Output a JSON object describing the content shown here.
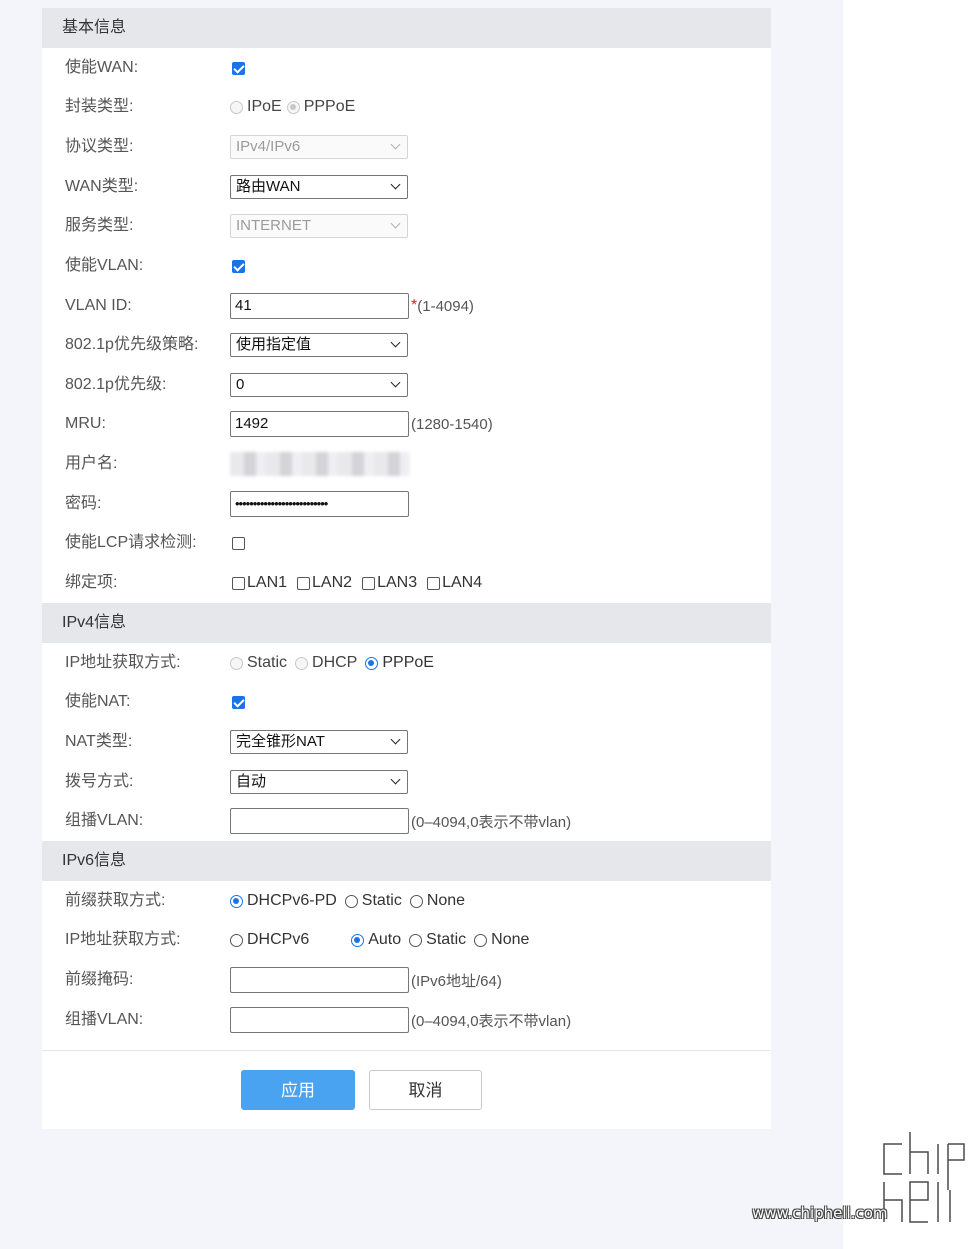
{
  "sections": {
    "basic": "基本信息",
    "ipv4": "IPv4信息",
    "ipv6": "IPv6信息"
  },
  "basic": {
    "enable_wan": {
      "label": "使能WAN:",
      "checked": true
    },
    "encap": {
      "label": "封装类型:",
      "options": [
        "IPoE",
        "PPPoE"
      ],
      "selected": "PPPoE"
    },
    "protocol": {
      "label": "协议类型:",
      "value": "IPv4/IPv6"
    },
    "wan_type": {
      "label": "WAN类型:",
      "value": "路由WAN"
    },
    "service": {
      "label": "服务类型:",
      "value": "INTERNET"
    },
    "enable_vlan": {
      "label": "使能VLAN:",
      "checked": true
    },
    "vlan_id": {
      "label": "VLAN ID:",
      "value": "41",
      "required": "*",
      "hint": "(1-4094)"
    },
    "p8021_policy": {
      "label": "802.1p优先级策略:",
      "value": "使用指定值"
    },
    "p8021": {
      "label": "802.1p优先级:",
      "value": "0"
    },
    "mru": {
      "label": "MRU:",
      "value": "1492",
      "hint": "(1280-1540)"
    },
    "username": {
      "label": "用户名:"
    },
    "password": {
      "label": "密码:",
      "value": "••••••••••••••••••••••••••"
    },
    "lcp": {
      "label": "使能LCP请求检测:",
      "checked": false
    },
    "bind": {
      "label": "绑定项:",
      "options": [
        "LAN1",
        "LAN2",
        "LAN3",
        "LAN4"
      ]
    }
  },
  "ipv4": {
    "ip_mode": {
      "label": "IP地址获取方式:",
      "options": [
        "Static",
        "DHCP",
        "PPPoE"
      ],
      "selected": "PPPoE"
    },
    "enable_nat": {
      "label": "使能NAT:",
      "checked": true
    },
    "nat_type": {
      "label": "NAT类型:",
      "value": "完全锥形NAT"
    },
    "dial": {
      "label": "拨号方式:",
      "value": "自动"
    },
    "mcast_vlan": {
      "label": "组播VLAN:",
      "value": "",
      "hint": "(0–4094,0表示不带vlan)"
    }
  },
  "ipv6": {
    "prefix_mode": {
      "label": "前缀获取方式:",
      "options": [
        "DHCPv6-PD",
        "Static",
        "None"
      ],
      "selected": "DHCPv6-PD"
    },
    "ip_mode": {
      "label": "IP地址获取方式:",
      "options": [
        "DHCPv6",
        "Auto",
        "Static",
        "None"
      ],
      "selected": "Auto"
    },
    "prefix_mask": {
      "label": "前缀掩码:",
      "value": "",
      "hint": "(IPv6地址/64)"
    },
    "mcast_vlan": {
      "label": "组播VLAN:",
      "value": "",
      "hint": "(0–4094,0表示不带vlan)"
    }
  },
  "buttons": {
    "apply": "应用",
    "cancel": "取消"
  },
  "watermark": {
    "logo": "chip hell",
    "url": "www.chiphell.com"
  },
  "colors": {
    "accent": "#1a73e8",
    "apply_button": "#4aa3f0",
    "section_bg": "#e6e7ea"
  }
}
